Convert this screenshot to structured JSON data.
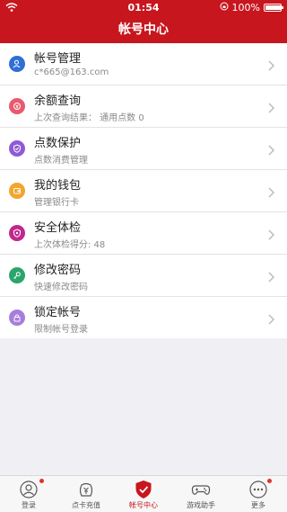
{
  "status_bar": {
    "time": "01:54",
    "battery": "100%",
    "battery_level": 1.0
  },
  "nav": {
    "title": "帐号中心"
  },
  "colors": {
    "brand": "#c8161e",
    "blue": "#2f6fd6",
    "pink": "#e85a6e",
    "purple": "#8f5ad6",
    "orange": "#f2a62c",
    "magenta": "#c0288c",
    "green": "#2aa56b",
    "lavender": "#a77ddd"
  },
  "menu": [
    {
      "title": "帐号管理",
      "subtitle": "c*665@163.com",
      "icon": "user-icon"
    },
    {
      "title": "余额查询",
      "subtitle": "上次查询结果： 通用点数 0",
      "icon": "balance-icon"
    },
    {
      "title": "点数保护",
      "subtitle": "点数消费管理",
      "icon": "shield-check-icon"
    },
    {
      "title": "我的钱包",
      "subtitle": "管理银行卡",
      "icon": "wallet-icon"
    },
    {
      "title": "安全体检",
      "subtitle": "上次体检得分: 48",
      "icon": "security-check-icon"
    },
    {
      "title": "修改密码",
      "subtitle": "快速修改密码",
      "icon": "key-icon"
    },
    {
      "title": "锁定帐号",
      "subtitle": "限制帐号登录",
      "icon": "lock-icon"
    }
  ],
  "tabs": [
    {
      "label": "登录",
      "icon": "login-icon",
      "badge": true
    },
    {
      "label": "点卡充值",
      "icon": "recharge-icon",
      "badge": false
    },
    {
      "label": "帐号中心",
      "icon": "account-center-icon",
      "badge": false,
      "active": true
    },
    {
      "label": "游戏助手",
      "icon": "gamepad-icon",
      "badge": false
    },
    {
      "label": "更多",
      "icon": "more-icon",
      "badge": true
    }
  ]
}
